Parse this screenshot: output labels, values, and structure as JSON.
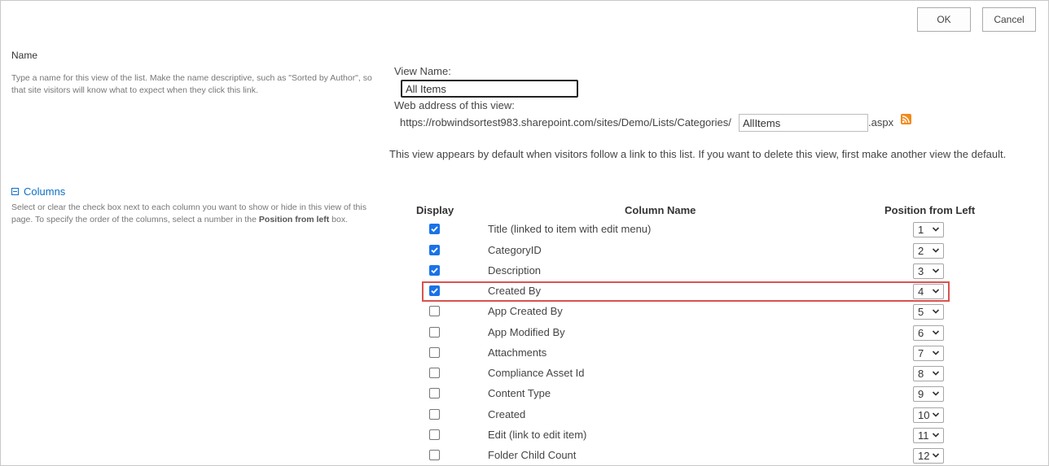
{
  "buttons": {
    "ok": "OK",
    "cancel": "Cancel"
  },
  "name_section": {
    "title": "Name",
    "description": "Type a name for this view of the list. Make the name descriptive, such as \"Sorted by Author\", so that site visitors will know what to expect when they click this link."
  },
  "view_name": {
    "label": "View Name:",
    "value": "All Items"
  },
  "web_address": {
    "label": "Web address of this view:",
    "url_prefix": "https://robwindsortest983.sharepoint.com/sites/Demo/Lists/Categories/",
    "value": "AllItems",
    "suffix": ".aspx",
    "rss_icon": "rss-icon"
  },
  "default_note": "This view appears by default when visitors follow a link to this list. If you want to delete this view, first make another view the default.",
  "columns_section": {
    "title": "Columns",
    "collapse_icon": "collapse-minus-icon",
    "description_pre": "Select or clear the check box next to each column you want to show or hide in this view of this page. To specify the order of the columns, select a number in the ",
    "description_bold": "Position from left",
    "description_post": " box."
  },
  "table": {
    "headers": {
      "display": "Display",
      "column_name": "Column Name",
      "position": "Position from Left"
    },
    "rows": [
      {
        "checked": true,
        "name": "Title (linked to item with edit menu)",
        "position": "1"
      },
      {
        "checked": true,
        "name": "CategoryID",
        "position": "2"
      },
      {
        "checked": true,
        "name": "Description",
        "position": "3"
      },
      {
        "checked": true,
        "name": "Created By",
        "position": "4"
      },
      {
        "checked": false,
        "name": "App Created By",
        "position": "5"
      },
      {
        "checked": false,
        "name": "App Modified By",
        "position": "6"
      },
      {
        "checked": false,
        "name": "Attachments",
        "position": "7"
      },
      {
        "checked": false,
        "name": "Compliance Asset Id",
        "position": "8"
      },
      {
        "checked": false,
        "name": "Content Type",
        "position": "9"
      },
      {
        "checked": false,
        "name": "Created",
        "position": "10"
      },
      {
        "checked": false,
        "name": "Edit (link to edit item)",
        "position": "11"
      },
      {
        "checked": false,
        "name": "Folder Child Count",
        "position": "12"
      }
    ]
  },
  "colors": {
    "checkbox_checked": "#1a73e8",
    "highlight_border": "#d9534f",
    "link": "#0f6fc6",
    "rss": "#f28a1a"
  }
}
